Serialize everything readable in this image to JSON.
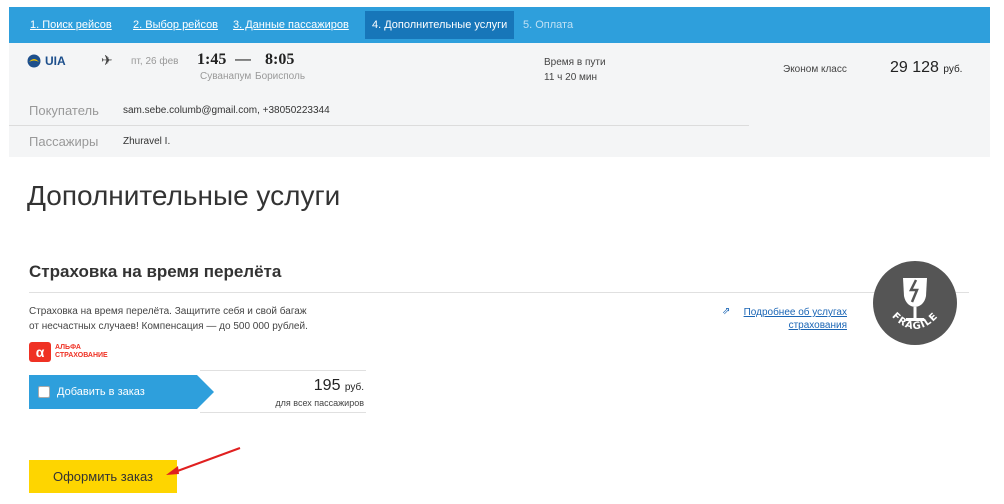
{
  "steps": [
    {
      "label": "1. Поиск рейсов",
      "state": "link"
    },
    {
      "label": "2. Выбор рейсов",
      "state": "link"
    },
    {
      "label": "3. Данные пассажиров",
      "state": "link"
    },
    {
      "label": "4. Дополнительные услуги",
      "state": "active"
    },
    {
      "label": "5. Оплата",
      "state": "disabled"
    }
  ],
  "flight": {
    "airline": "UIA",
    "date": "пт, 26 фев",
    "dep_time": "1:45",
    "arr_time": "8:05",
    "dep_city": "Суванапум",
    "arr_city": "Борисполь",
    "duration_label": "Время в пути",
    "duration_value": "11 ч 20 мин",
    "cabin": "Эконом класс",
    "price": "29 128",
    "currency": "руб."
  },
  "buyer": {
    "label": "Покупатель",
    "value": "sam.sebe.columb@gmail.com, +38050223344"
  },
  "passengers": {
    "label": "Пассажиры",
    "value": "Zhuravel I."
  },
  "page_title": "Дополнительные услуги",
  "insurance": {
    "title": "Страховка на время перелёта",
    "desc_line1": "Страховка на время перелёта. Защитите себя и свой багаж",
    "desc_line2": "от несчастных случаев! Компенсация — до 500 000 рублей.",
    "provider_line1": "АЛЬФА",
    "provider_line2": "СТРАХОВАНИЕ",
    "provider_mark": "α",
    "add_label": "Добавить в заказ",
    "price": "195",
    "currency": "руб.",
    "price_note": "для всех пассажиров",
    "more_link_line1": "Подробнее об услугах",
    "more_link_line2": "страхования",
    "badge_text": "FRAGILE"
  },
  "order_button": "Оформить заказ",
  "colors": {
    "accent": "#2e9fdc",
    "active_step": "#1776b9",
    "order_button": "#fed500",
    "arrow": "#e02020"
  }
}
